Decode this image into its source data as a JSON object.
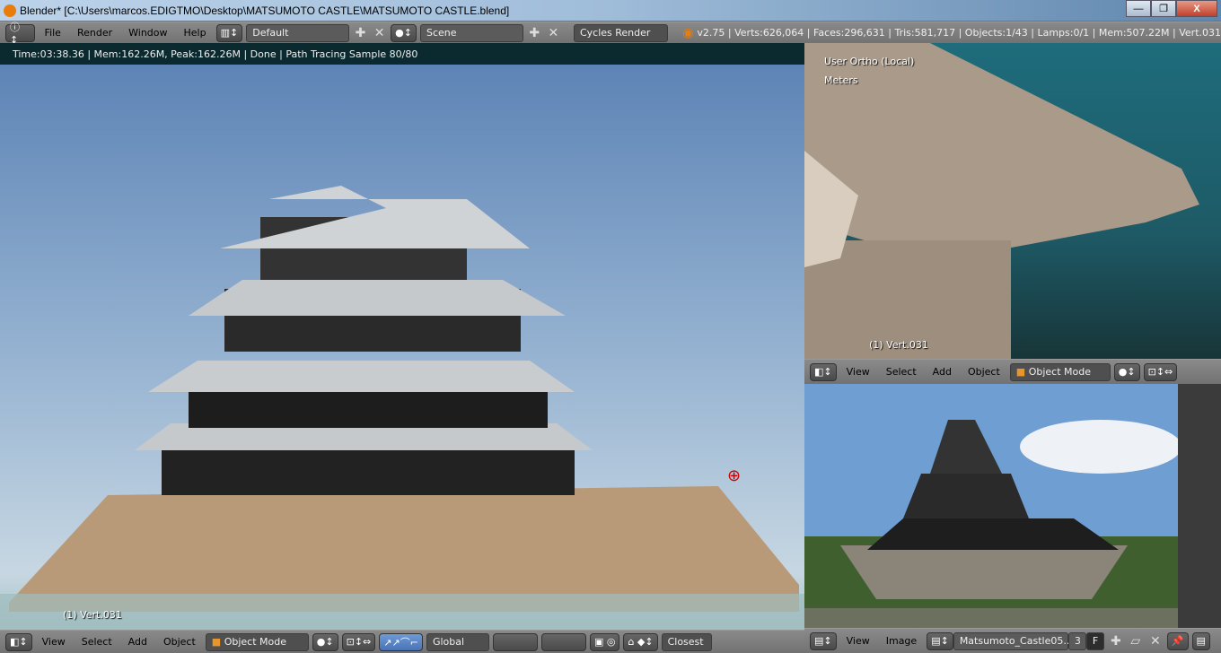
{
  "window": {
    "title": "Blender* [C:\\Users\\marcos.EDIGTMO\\Desktop\\MATSUMOTO CASTLE\\MATSUMOTO CASTLE.blend]",
    "minimize": "—",
    "restore": "❐",
    "close": "X"
  },
  "info_header": {
    "menus": [
      "File",
      "Render",
      "Window",
      "Help"
    ],
    "layout": "Default",
    "scene": "Scene",
    "engine": "Cycles Render",
    "stats": "v2.75 | Verts:626,064 | Faces:296,631 | Tris:581,717 | Objects:1/43 | Lamps:0/1 | Mem:507.22M | Vert.031"
  },
  "render_status": "Time:03:38.36 | Mem:162.26M, Peak:162.26M | Done | Path Tracing Sample 80/80",
  "main_view": {
    "object_label": "(1) Vert.031",
    "header": {
      "menus": [
        "View",
        "Select",
        "Add",
        "Object"
      ],
      "mode": "Object Mode",
      "orientation": "Global",
      "snap": "Closest"
    }
  },
  "top_view": {
    "view_name": "User Ortho (Local)",
    "units": "Meters",
    "object_label": "(1) Vert.031",
    "header": {
      "menus": [
        "View",
        "Select",
        "Add",
        "Object"
      ],
      "mode": "Object Mode"
    }
  },
  "image_editor": {
    "header": {
      "menus": [
        "View",
        "Image"
      ],
      "image_name": "Matsumoto_Castle05...",
      "users": "3",
      "fake": "F"
    }
  }
}
